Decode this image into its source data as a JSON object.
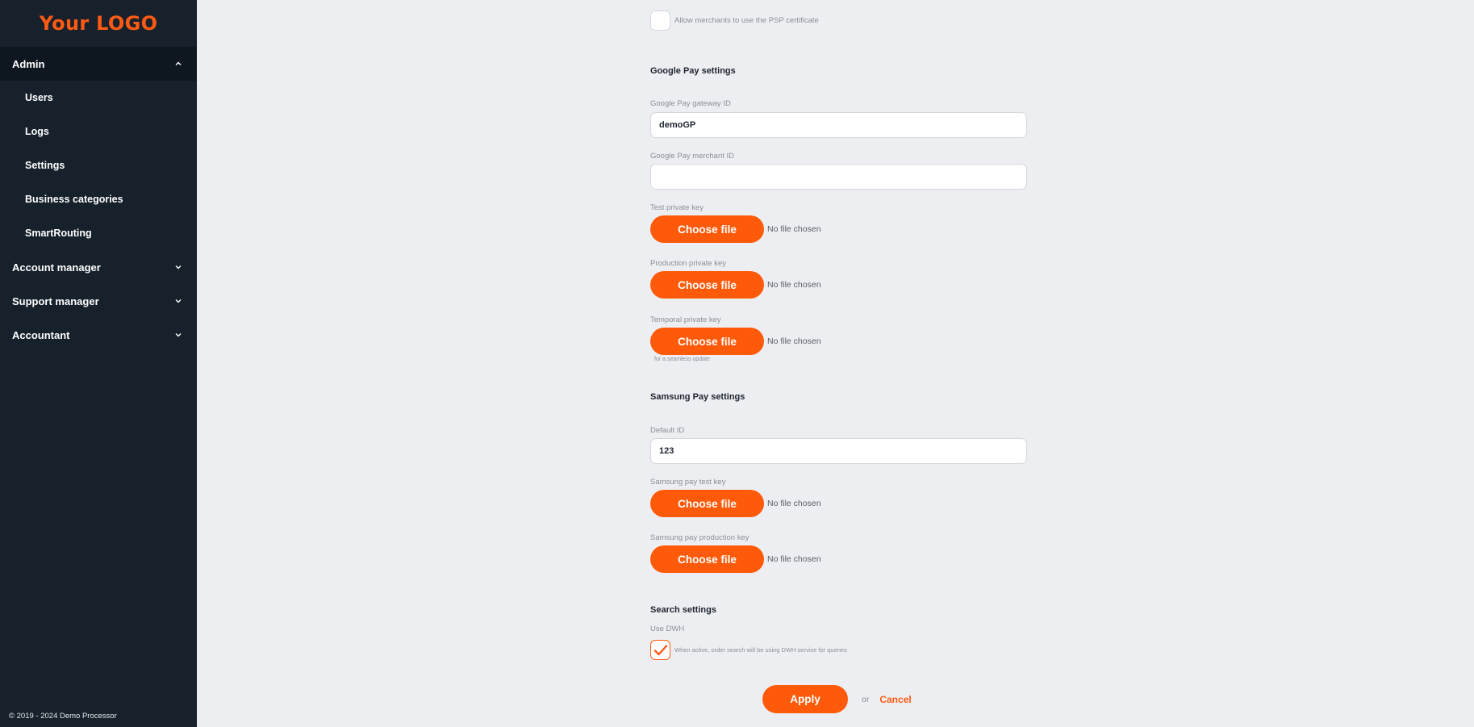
{
  "sidebar": {
    "logo": "Your LOGO",
    "admin": {
      "label": "Admin",
      "items": [
        {
          "label": "Users"
        },
        {
          "label": "Logs"
        },
        {
          "label": "Settings"
        },
        {
          "label": "Business categories"
        },
        {
          "label": "SmartRouting"
        }
      ]
    },
    "groups": [
      {
        "label": "Account manager"
      },
      {
        "label": "Support manager"
      },
      {
        "label": "Accountant"
      }
    ],
    "footer": "© 2019 - 2024 Demo Processor"
  },
  "form": {
    "psp_certificate": {
      "label": "Allow merchants to use the PSP certificate",
      "checked": false
    },
    "google_pay": {
      "title": "Google Pay settings",
      "gateway_id": {
        "label": "Google Pay gateway ID",
        "value": "demoGP"
      },
      "merchant_id": {
        "label": "Google Pay merchant ID",
        "value": ""
      },
      "test_key": {
        "label": "Test private key",
        "button": "Choose file",
        "status": "No file chosen"
      },
      "production_key": {
        "label": "Production private key",
        "button": "Choose file",
        "status": "No file chosen"
      },
      "temporal_key": {
        "label": "Temporal private key",
        "button": "Choose file",
        "status": "No file chosen",
        "hint": "for a seamless update"
      }
    },
    "samsung_pay": {
      "title": "Samsung Pay settings",
      "default_id": {
        "label": "Default ID",
        "value": "123"
      },
      "test_key": {
        "label": "Samsung pay test key",
        "button": "Choose file",
        "status": "No file chosen"
      },
      "production_key": {
        "label": "Samsung pay production key",
        "button": "Choose file",
        "status": "No file chosen"
      }
    },
    "search": {
      "title": "Search settings",
      "use_dwh": {
        "label": "Use DWH",
        "description": "When active, order search will be using DWH service for queries",
        "checked": true
      }
    },
    "actions": {
      "apply": "Apply",
      "or": "or",
      "cancel": "Cancel"
    }
  },
  "colors": {
    "accent": "#ff5a0a",
    "sidebar_bg": "#16212b",
    "page_bg": "#edeef1"
  }
}
